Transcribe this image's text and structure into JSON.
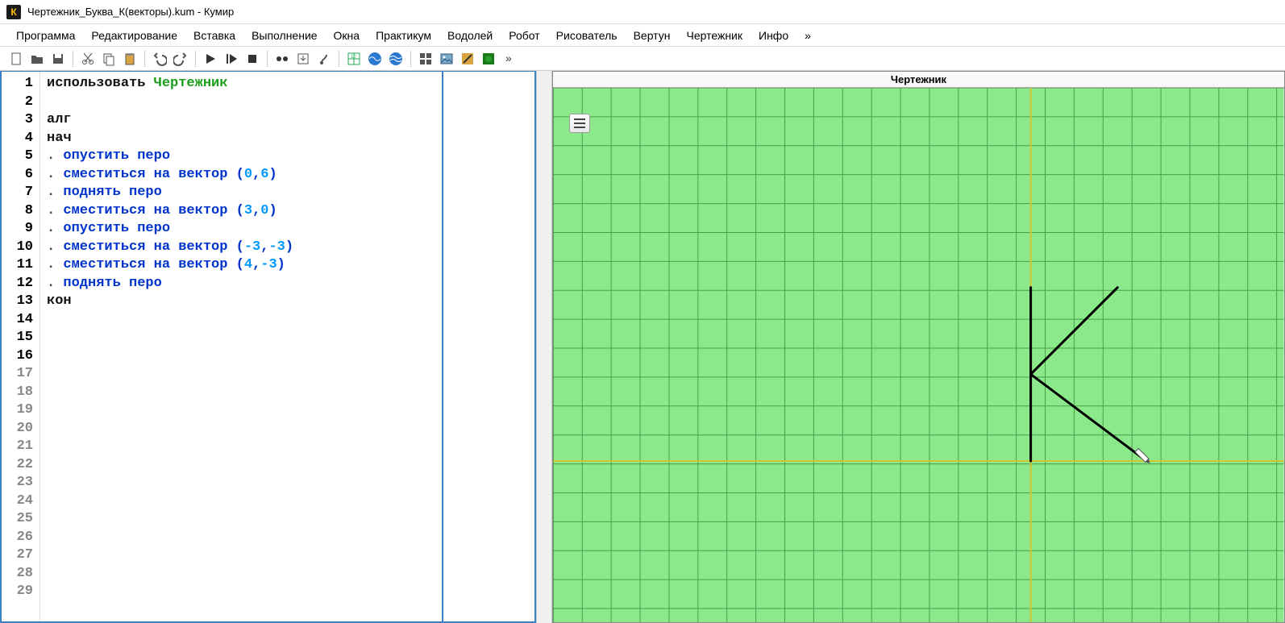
{
  "window": {
    "title": "Чертежник_Буква_К(векторы).kum - Кумир",
    "app_icon_letter": "К"
  },
  "menubar": [
    "Программа",
    "Редактирование",
    "Вставка",
    "Выполнение",
    "Окна",
    "Практикум",
    "Водолей",
    "Робот",
    "Рисователь",
    "Вертун",
    "Чертежник",
    "Инфо",
    "»"
  ],
  "toolbar_icons": [
    "new-file-icon",
    "open-file-icon",
    "save-icon",
    "sep",
    "cut-icon",
    "copy-icon",
    "paste-icon",
    "sep",
    "undo-icon",
    "redo-icon",
    "sep",
    "run-icon",
    "step-icon",
    "stop-icon",
    "sep",
    "breakpoint-icon",
    "step-into-icon",
    "step-out-icon",
    "sep",
    "grid-icon",
    "waves-icon",
    "waves2-icon",
    "sep",
    "modules-icon",
    "image-icon",
    "palette-icon",
    "turtle-icon",
    "more-icon"
  ],
  "code": {
    "lines": [
      {
        "type": "use",
        "keyword": "использовать",
        "module": "Чертежник"
      },
      {
        "type": "blank"
      },
      {
        "type": "kw",
        "text": "алг"
      },
      {
        "type": "kw",
        "text": "нач"
      },
      {
        "type": "cmd",
        "indent": 1,
        "text": "опустить перо"
      },
      {
        "type": "vec",
        "indent": 1,
        "cmd": "сместиться на вектор",
        "args": [
          "0",
          "6"
        ]
      },
      {
        "type": "cmd",
        "indent": 1,
        "text": "поднять перо"
      },
      {
        "type": "vec",
        "indent": 1,
        "cmd": "сместиться на вектор",
        "args": [
          "3",
          "0"
        ]
      },
      {
        "type": "cmd",
        "indent": 1,
        "text": "опустить перо"
      },
      {
        "type": "vec",
        "indent": 1,
        "cmd": "сместиться на вектор",
        "args": [
          "-3",
          "-3"
        ]
      },
      {
        "type": "vec",
        "indent": 1,
        "cmd": "сместиться на вектор",
        "args": [
          "4",
          "-3"
        ]
      },
      {
        "type": "cmd",
        "indent": 1,
        "text": "поднять перо"
      },
      {
        "type": "kw",
        "text": "кон"
      }
    ],
    "total_visible_lines": 29,
    "filled_lines": 16
  },
  "canvas": {
    "title": "Чертежник",
    "cell_size": 36,
    "origin": {
      "col": 16.5,
      "row": 12.9
    },
    "drawing": [
      {
        "from": [
          0,
          0
        ],
        "to": [
          0,
          6
        ]
      },
      {
        "move_to": [
          3,
          6
        ]
      },
      {
        "from": [
          3,
          6
        ],
        "to": [
          0,
          3
        ]
      },
      {
        "from": [
          0,
          3
        ],
        "to": [
          4,
          0
        ]
      }
    ],
    "pen_pos": [
      4,
      0
    ]
  }
}
